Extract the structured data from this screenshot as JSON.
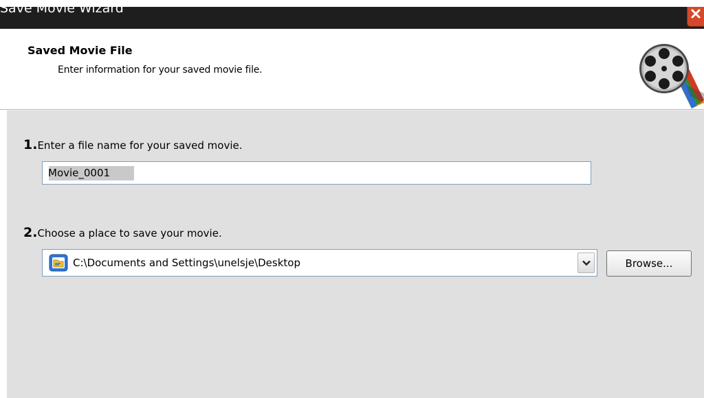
{
  "window": {
    "title": "Save Movie Wizard"
  },
  "header": {
    "title": "Saved Movie File",
    "subtitle": "Enter information for your saved movie file.",
    "icon": "film-reel-icon"
  },
  "steps": [
    {
      "number": "1.",
      "label": "Enter a file name for your saved movie."
    },
    {
      "number": "2.",
      "label": "Choose a place to save your movie."
    }
  ],
  "filename_input": {
    "value": "Movie_0001"
  },
  "location_combo": {
    "value": "C:\\Documents and Settings\\unelsje\\Desktop",
    "icon": "folder-icon"
  },
  "browse_button": {
    "label": "Browse..."
  },
  "colors": {
    "titlebar": "#1e1e1e",
    "close_button": "#d6482b",
    "content_background": "#e0e0e0",
    "input_border": "#7f9db9"
  }
}
